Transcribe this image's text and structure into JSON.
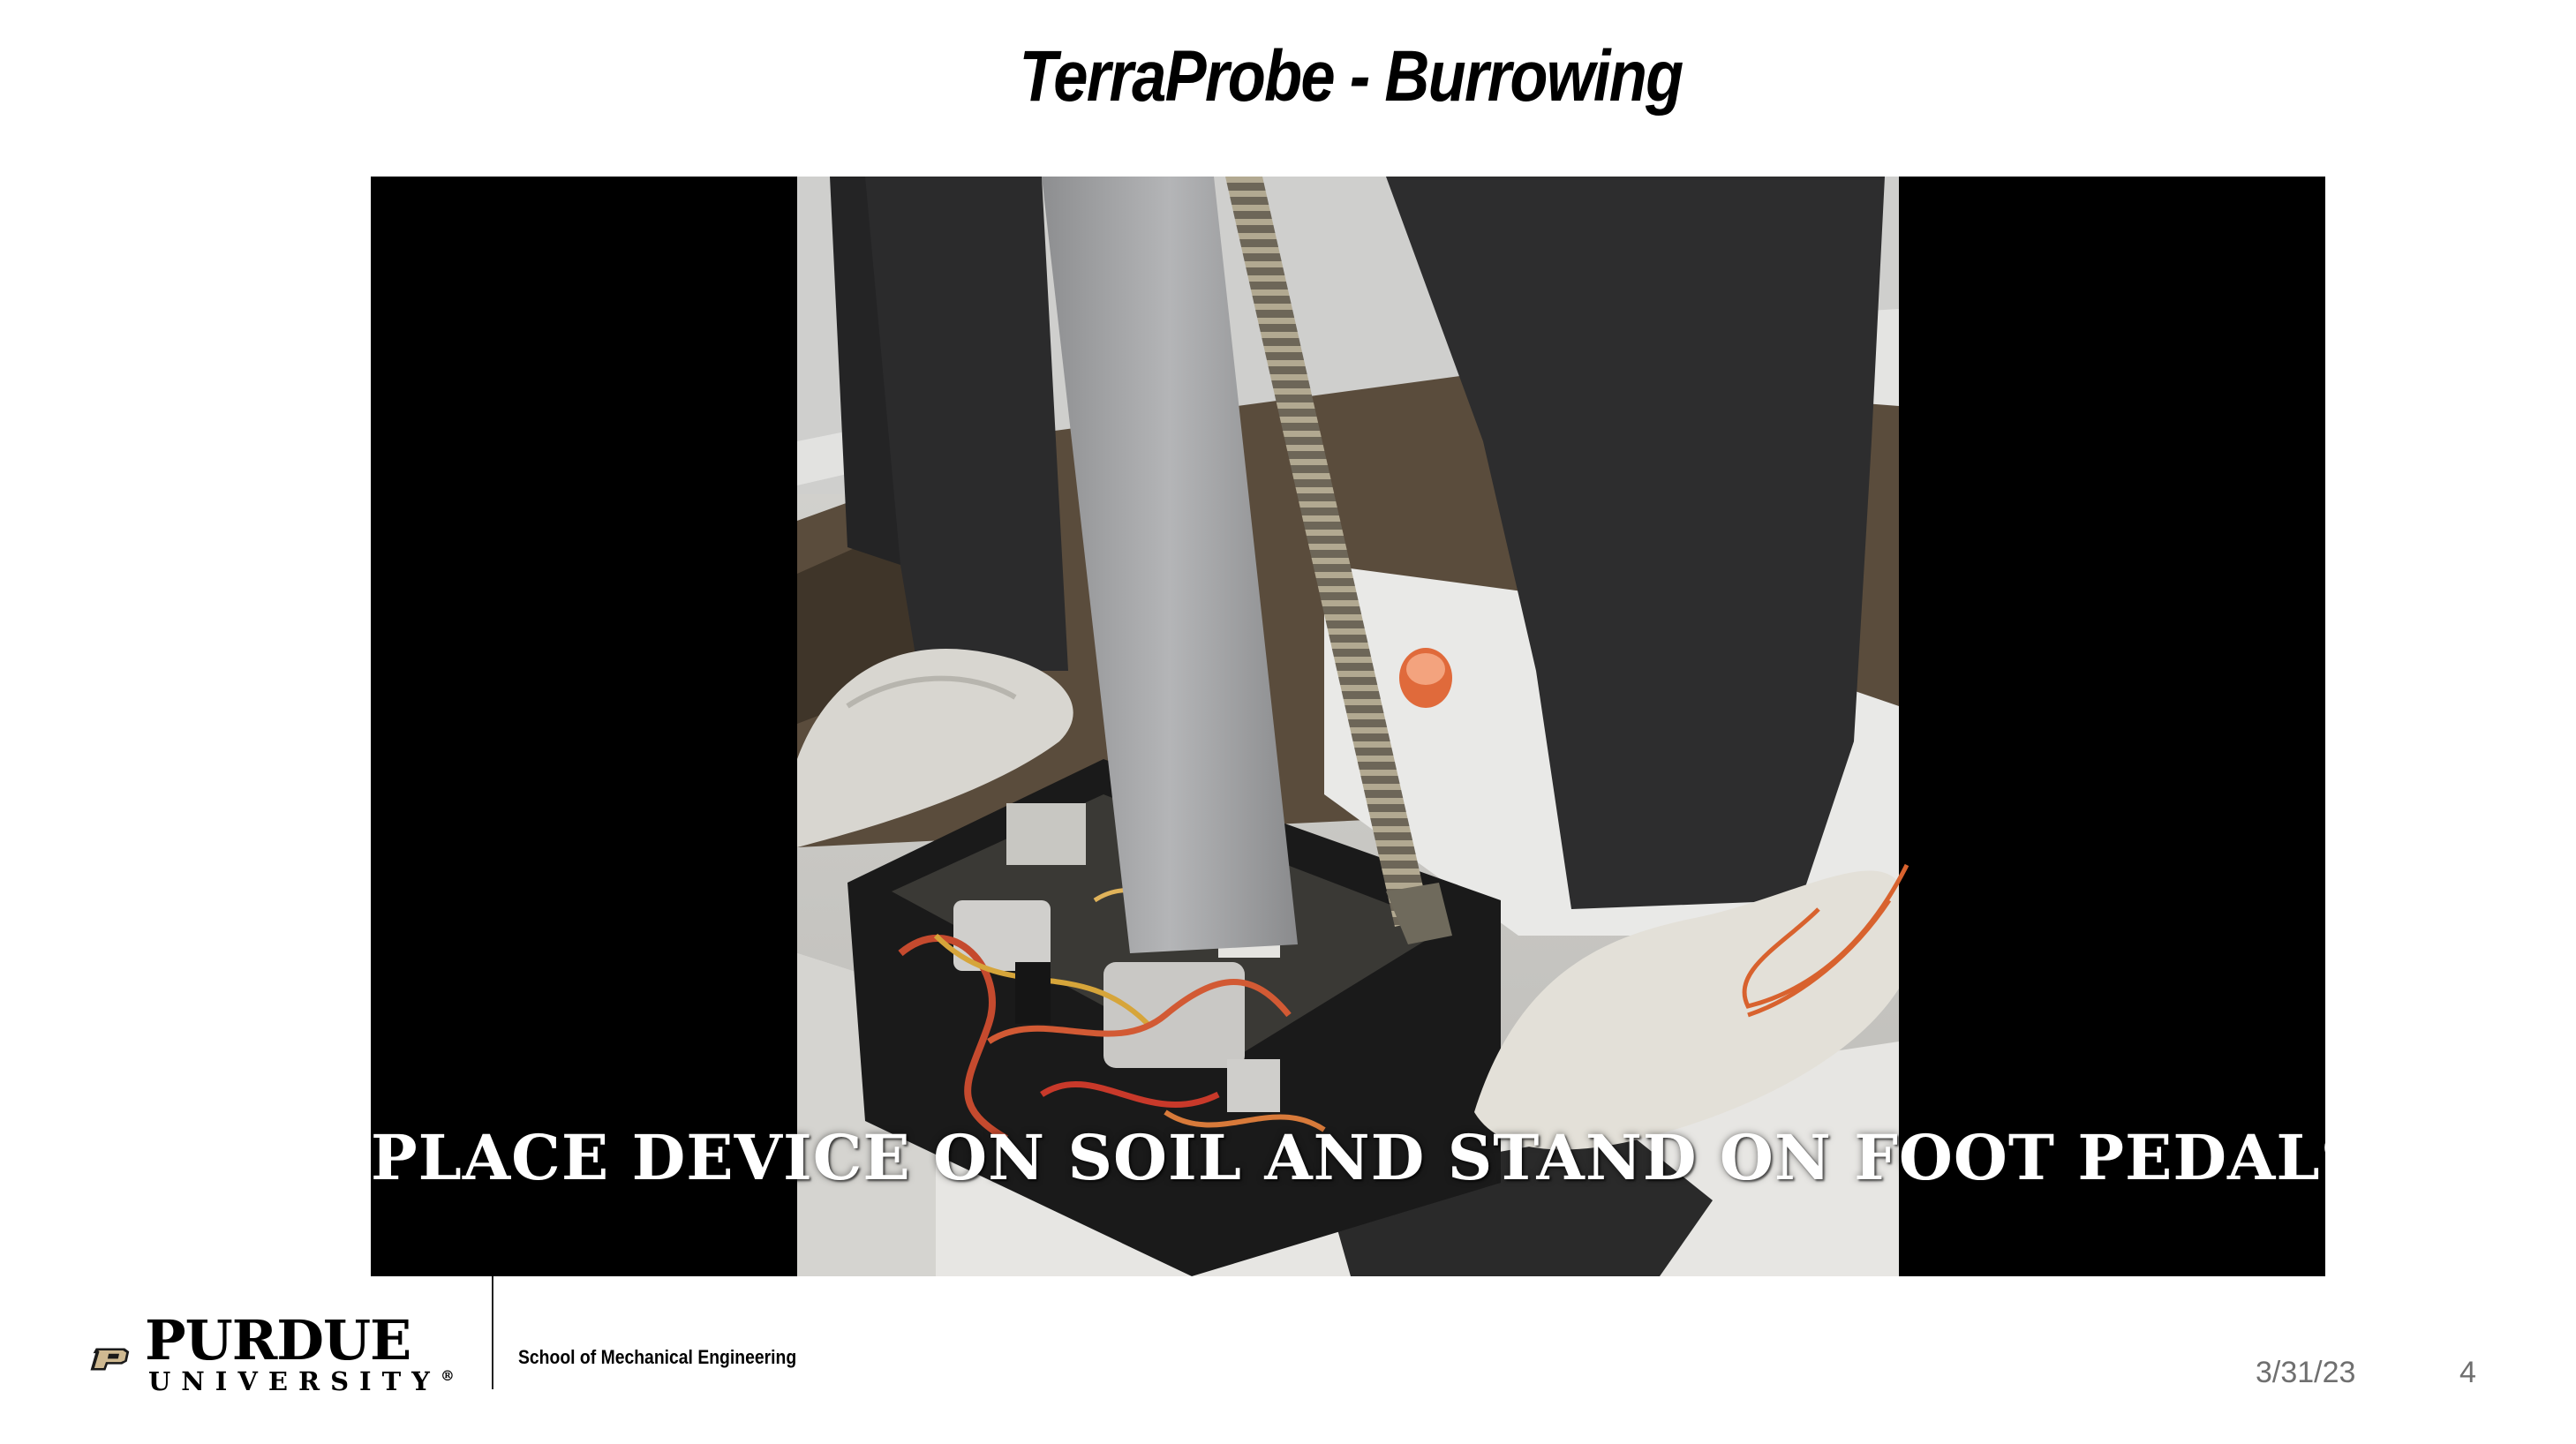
{
  "slide": {
    "title": "TerraProbe - Burrowing",
    "video_caption": "PLACE DEVICE ON SOIL AND STAND ON FOOT PEDALS",
    "footer": {
      "logo_word": "PURDUE",
      "logo_subword": "UNIVERSITY",
      "registered_mark": "®",
      "department": "School of Mechanical Engineering",
      "date": "3/31/23",
      "page_number": "4"
    }
  },
  "colors": {
    "purdue_gold": "#CFB991",
    "black": "#000000",
    "footer_text": "#6F6F6F"
  }
}
